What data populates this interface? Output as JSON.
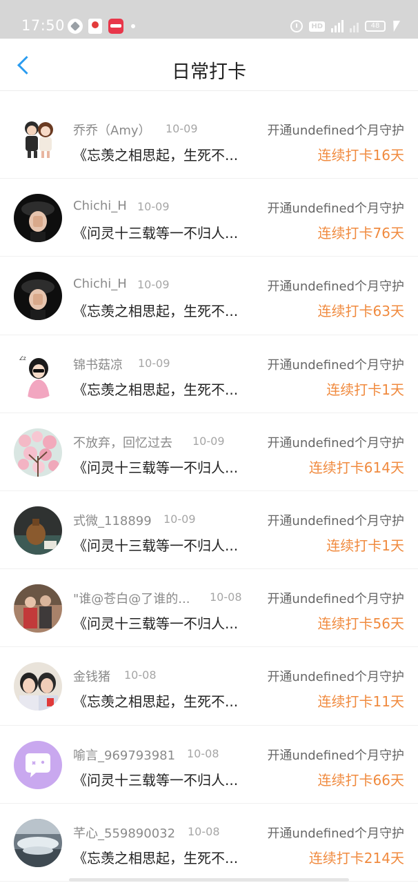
{
  "status_bar": {
    "time": "17:50",
    "battery": "48"
  },
  "header": {
    "title": "日常打卡"
  },
  "rows": [
    {
      "name": "乔乔（Amy）",
      "date": "10-09",
      "guard": "开通undefined个月守护",
      "message": "《忘羡之相思起，生死不...",
      "streak": "连续打卡16天",
      "avatar": "cartoon-couple"
    },
    {
      "name": "Chichi_H",
      "date": "10-09",
      "guard": "开通undefined个月守护",
      "message": "《问灵十三载等一不归人...",
      "streak": "连续打卡76天",
      "avatar": "girl-black-hat"
    },
    {
      "name": "Chichi_H",
      "date": "10-09",
      "guard": "开通undefined个月守护",
      "message": "《忘羡之相思起，生死不...",
      "streak": "连续打卡63天",
      "avatar": "girl-black-hat"
    },
    {
      "name": "锦书菇凉",
      "date": "10-09",
      "guard": "开通undefined个月守护",
      "message": "《忘羡之相思起，生死不...",
      "streak": "连续打卡1天",
      "avatar": "cartoon-girl-pink"
    },
    {
      "name": "不放弃，回忆过去",
      "date": "10-09",
      "guard": "开通undefined个月守护",
      "message": "《问灵十三载等一不归人...",
      "streak": "连续打卡614天",
      "avatar": "pink-blossom"
    },
    {
      "name": "式微_118899",
      "date": "10-09",
      "guard": "开通undefined个月守护",
      "message": "《问灵十三载等一不归人...",
      "streak": "连续打卡1天",
      "avatar": "vase-dark"
    },
    {
      "name": "\"谁@苍白@了谁的...",
      "date": "10-08",
      "guard": "开通undefined个月守护",
      "message": "《问灵十三载等一不归人...",
      "streak": "连续打卡56天",
      "avatar": "photo-people"
    },
    {
      "name": "金钱猪",
      "date": "10-08",
      "guard": "开通undefined个月守护",
      "message": "《忘羡之相思起，生死不...",
      "streak": "连续打卡11天",
      "avatar": "two-girls"
    },
    {
      "name": "喻言_969793981",
      "date": "10-08",
      "guard": "开通undefined个月守护",
      "message": "《问灵十三载等一不归人...",
      "streak": "连续打卡66天",
      "avatar": "default-chat"
    },
    {
      "name": "芊心_559890032",
      "date": "10-08",
      "guard": "开通undefined个月守护",
      "message": "《忘羡之相思起，生死不...",
      "streak": "连续打卡214天",
      "avatar": "waterfall"
    }
  ],
  "colors": {
    "accent": "#2a9cf0",
    "streak": "#f08a3e"
  }
}
